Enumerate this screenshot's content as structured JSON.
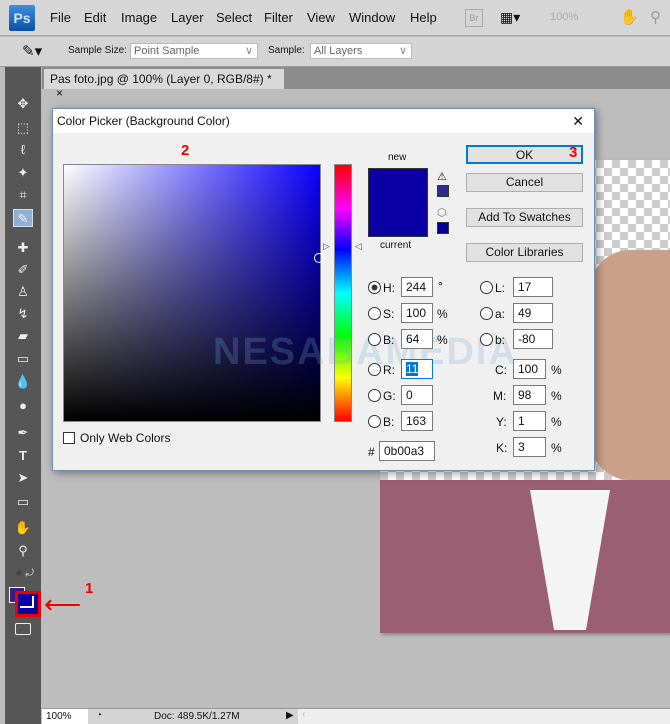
{
  "app": {
    "logo": "Ps",
    "menu": [
      "File",
      "Edit",
      "Image",
      "Layer",
      "Select",
      "Filter",
      "View",
      "Window",
      "Help"
    ],
    "bridge": "Br",
    "zoom": "100%"
  },
  "options": {
    "sample_size_label": "Sample Size:",
    "sample_size_value": "Point Sample",
    "sample_label": "Sample:",
    "sample_value": "All Layers"
  },
  "document": {
    "tab_title": "Pas foto.jpg @ 100% (Layer 0, RGB/8#) *",
    "close": "×"
  },
  "status": {
    "zoom": "100%",
    "doc": "Doc: 489.5K/1.27M"
  },
  "dialog": {
    "title": "Color Picker (Background Color)",
    "close": "✕",
    "new_label": "new",
    "current_label": "current",
    "new_color": "#0b00a3",
    "current_color": "#0b00a3",
    "gamut_color": "#2f2a8e",
    "websafe_color": "#000099",
    "ok": "OK",
    "cancel": "Cancel",
    "add_swatches": "Add To Swatches",
    "color_libraries": "Color Libraries",
    "only_web_colors": "Only Web Colors",
    "hsb": [
      {
        "label": "H:",
        "value": "244",
        "unit": "°",
        "selected": true
      },
      {
        "label": "S:",
        "value": "100",
        "unit": "%"
      },
      {
        "label": "B:",
        "value": "64",
        "unit": "%"
      }
    ],
    "rgb": [
      {
        "label": "R:",
        "value": "11"
      },
      {
        "label": "G:",
        "value": "0"
      },
      {
        "label": "B:",
        "value": "163"
      }
    ],
    "lab": [
      {
        "label": "L:",
        "value": "17"
      },
      {
        "label": "a:",
        "value": "49"
      },
      {
        "label": "b:",
        "value": "-80"
      }
    ],
    "cmyk": [
      {
        "label": "C:",
        "value": "100",
        "unit": "%"
      },
      {
        "label": "M:",
        "value": "98",
        "unit": "%"
      },
      {
        "label": "Y:",
        "value": "1",
        "unit": "%"
      },
      {
        "label": "K:",
        "value": "3",
        "unit": "%"
      }
    ],
    "hex_label": "#",
    "hex": "0b00a3"
  },
  "annotations": {
    "one": "1",
    "two": "2",
    "three": "3"
  },
  "watermark": "NESABAMEDIA",
  "colors": {
    "foreground": "#3a1a8a",
    "background": "#0b00a3",
    "annotation": "#e00000"
  }
}
